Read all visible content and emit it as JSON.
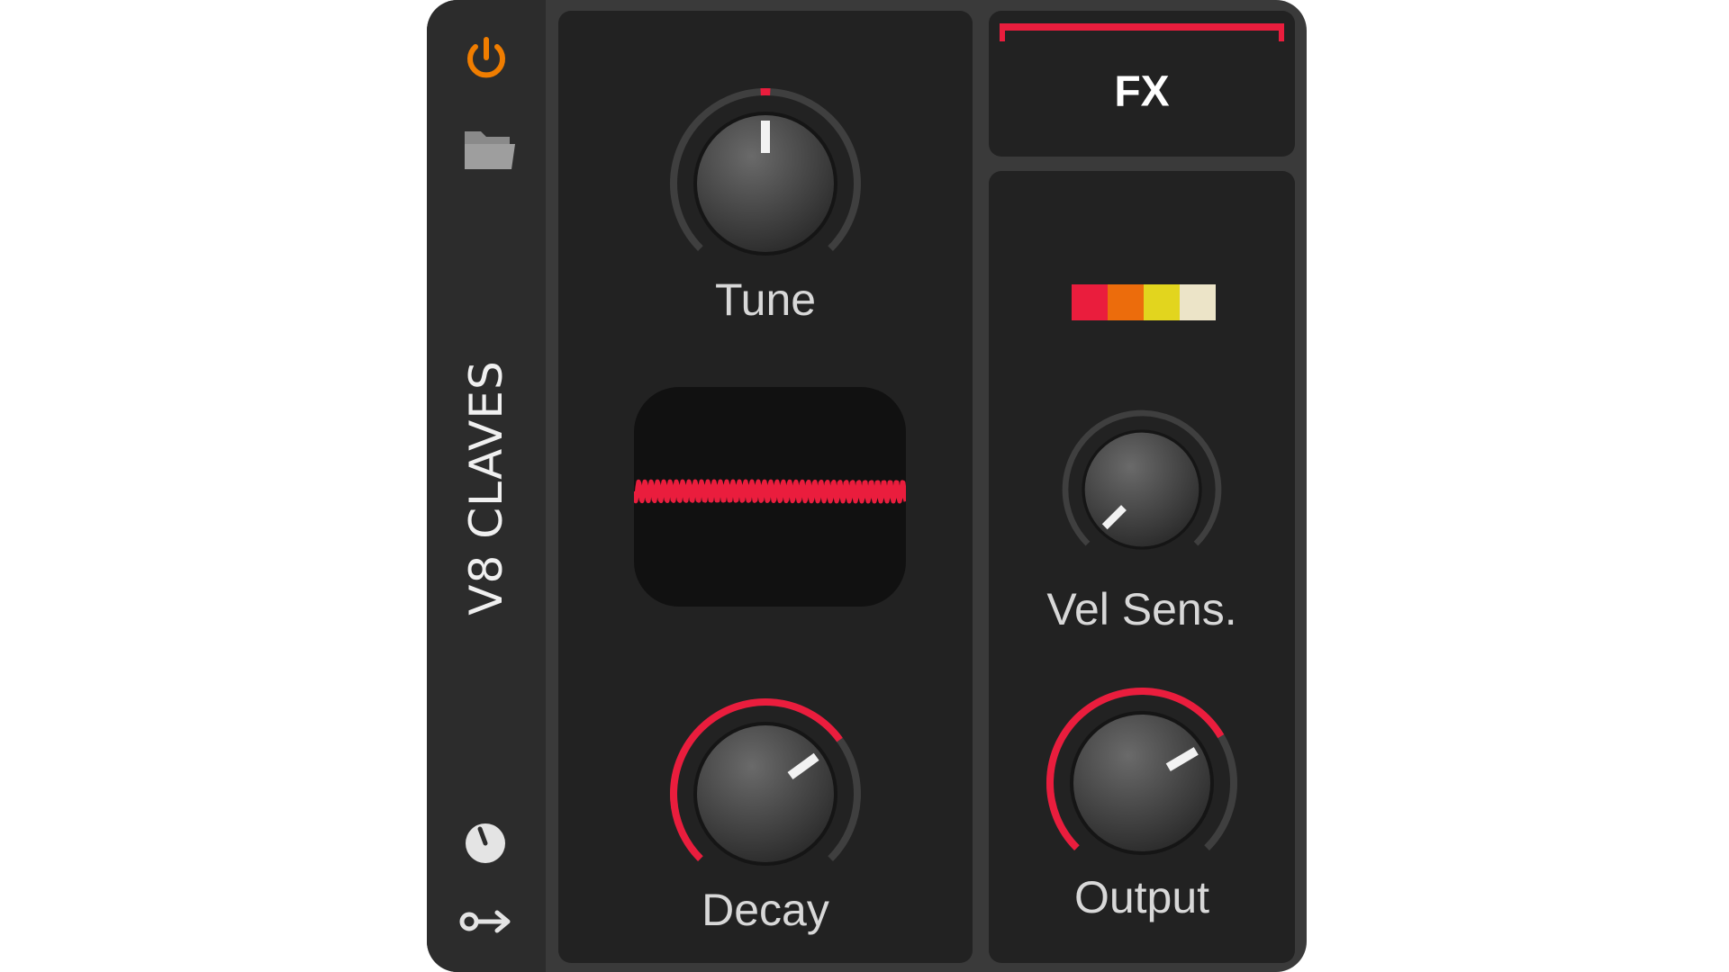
{
  "device": {
    "title": "V8 CLAVES"
  },
  "sidebar": {
    "icons": [
      {
        "name": "power-icon",
        "color": "#f07d00"
      },
      {
        "name": "folder-icon",
        "color": "#9a9a9a"
      },
      {
        "name": "modulation-knob-icon",
        "color": "#e0e0e0"
      },
      {
        "name": "key-arrow-icon",
        "color": "#e0e0e0"
      }
    ]
  },
  "knobs": {
    "tune": {
      "label": "Tune",
      "value": 0.5,
      "bipolar": true
    },
    "decay": {
      "label": "Decay",
      "value": 0.7
    },
    "vel_sens": {
      "label": "Vel Sens.",
      "value": 0.0
    },
    "output": {
      "label": "Output",
      "value": 0.72
    }
  },
  "fx": {
    "label": "FX"
  },
  "swatches": [
    "#ea1d3d",
    "#ec6c0c",
    "#e2d51e",
    "#ece4c8"
  ],
  "colors": {
    "accent": "#ea1d3d",
    "track": "#3f3f3f",
    "pointer": "#f2f2f2"
  }
}
